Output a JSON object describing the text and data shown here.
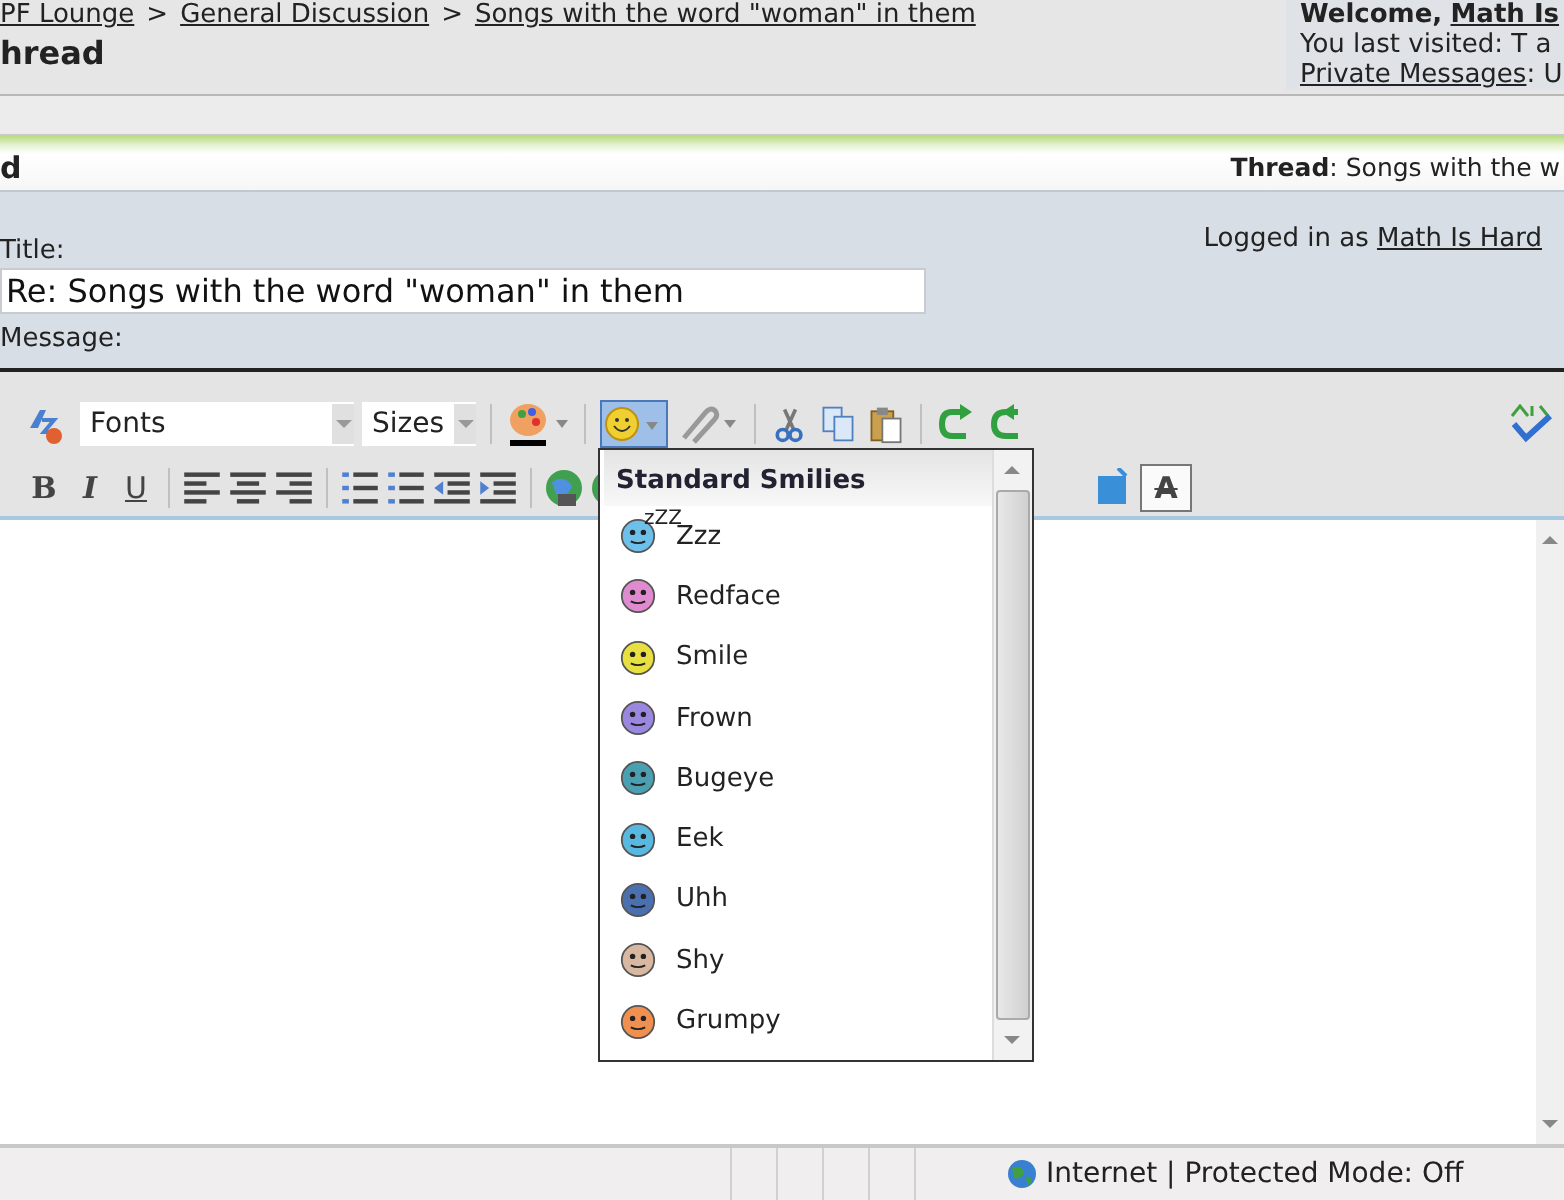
{
  "breadcrumbs": [
    {
      "label": "PF Lounge"
    },
    {
      "label": "General Discussion"
    },
    {
      "label": "Songs with the word \"woman\" in them"
    }
  ],
  "breadcrumb_separator": ">",
  "page_heading": "hread",
  "user_panel": {
    "welcome": "Welcome,",
    "user": "Math Is",
    "last_visited": "You last visited: T a",
    "private_messages": "Private Messages",
    "pm_rest": ": U"
  },
  "section_bar": {
    "heading": "d",
    "thread_label": "Thread",
    "thread_title": ": Songs with the w"
  },
  "form": {
    "title_label": "Title:",
    "title_value": "Re: Songs with the word \"woman\" in them",
    "logged_in_text": "Logged in as",
    "logged_in_user": "Math Is Hard",
    "message_label": "Message:"
  },
  "toolbar": {
    "font_select": "Fonts",
    "size_select": "Sizes",
    "smilies_expanded": true,
    "format_buttons": [
      "B",
      "I",
      "U"
    ],
    "remove_format": "A"
  },
  "smilies_menu": {
    "title": "Standard Smilies",
    "items": [
      {
        "name": "Zzz",
        "color": "#6cc0ea",
        "badge": "zZZ"
      },
      {
        "name": "Redface",
        "color": "#e08ad0"
      },
      {
        "name": "Smile",
        "color": "#e8e040"
      },
      {
        "name": "Frown",
        "color": "#9a88e0"
      },
      {
        "name": "Bugeye",
        "color": "#4aa0b0"
      },
      {
        "name": "Eek",
        "color": "#58b8e0"
      },
      {
        "name": "Uhh",
        "color": "#4a70b0"
      },
      {
        "name": "Shy",
        "color": "#d8b8a0"
      },
      {
        "name": "Grumpy",
        "color": "#f09050"
      }
    ]
  },
  "status_bar": {
    "zone": "Internet | Protected Mode: Off"
  }
}
